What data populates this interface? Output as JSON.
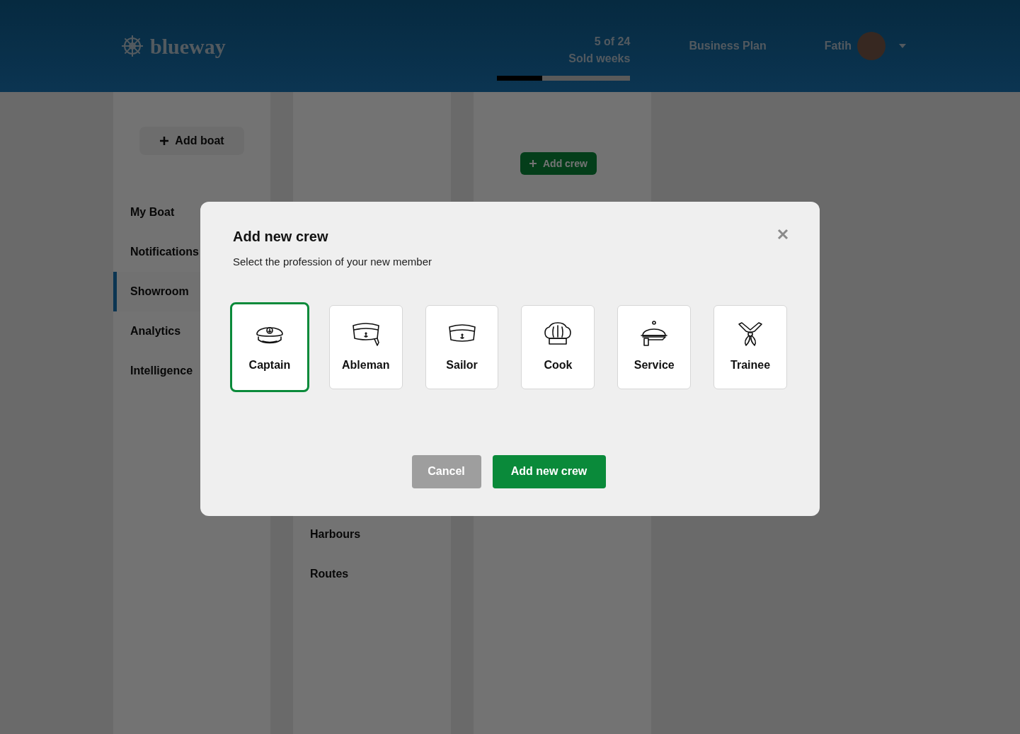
{
  "header": {
    "logo": "blueway",
    "progress": {
      "value": "5 of 24",
      "label": "Sold weeks",
      "level": 0.34
    },
    "nav_link": "Business Plan",
    "user": {
      "name": "Fatih"
    }
  },
  "sidebar": {
    "add_button": "Add boat",
    "items": [
      {
        "label": "My Boat",
        "selected": false
      },
      {
        "label": "Notifications",
        "selected": false
      },
      {
        "label": "Showroom",
        "selected": true
      },
      {
        "label": "Analytics",
        "selected": false
      },
      {
        "label": "Intelligence",
        "selected": false
      }
    ]
  },
  "column_2": {
    "items": [
      "Harbours",
      "Routes"
    ]
  },
  "column_3": {
    "add_button": "Add crew"
  },
  "modal": {
    "title": "Add new crew",
    "subtitle": "Select the profession of your new member",
    "options": [
      {
        "label": "Captain",
        "kind": "captain",
        "selected": true
      },
      {
        "label": "Ableman",
        "kind": "ableman",
        "selected": false
      },
      {
        "label": "Sailor",
        "kind": "sailor",
        "selected": false
      },
      {
        "label": "Cook",
        "kind": "cook",
        "selected": false
      },
      {
        "label": "Service",
        "kind": "service",
        "selected": false
      },
      {
        "label": "Trainee",
        "kind": "trainee",
        "selected": false
      }
    ],
    "buttons": {
      "cancel": "Cancel",
      "confirm": "Add new crew"
    }
  }
}
